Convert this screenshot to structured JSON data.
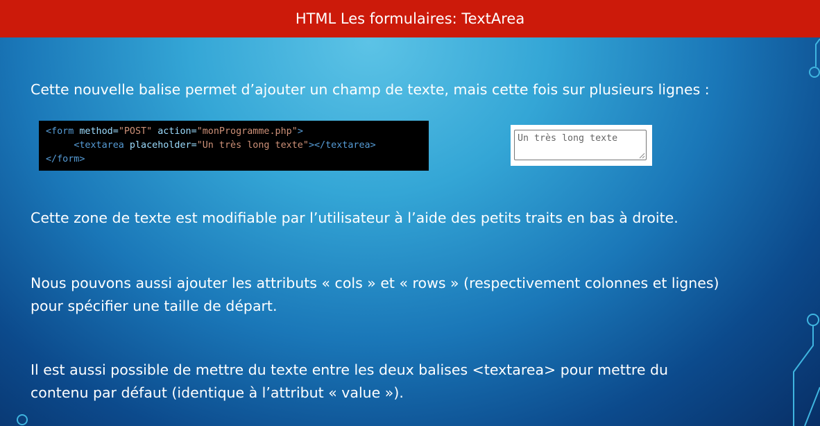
{
  "slide": {
    "title": "HTML Les formulaires: TextArea"
  },
  "paragraphs": {
    "intro": "Cette nouvelle balise permet d’ajouter un champ de texte, mais cette fois sur plusieurs lignes :",
    "resize": "Cette zone de texte est modifiable par l’utilisateur à l’aide des petits traits en bas à droite.",
    "cols_rows_line1": "Nous pouvons aussi ajouter les attributs « cols » et « rows » (respectivement colonnes et lignes)",
    "cols_rows_line2": "pour spécifier une taille de départ.",
    "default_line1": "Il est aussi possible de mettre du texte entre les deux balises <textarea> pour mettre du",
    "default_line2": "contenu par défaut (identique à l’attribut « value »)."
  },
  "code": {
    "line1": {
      "open": "<form",
      "attr1": " method=",
      "val1": "\"POST\"",
      "attr2": " action=",
      "val2": "\"monProgramme.php\"",
      "close": ">"
    },
    "line2": {
      "indent": "     ",
      "open": "<textarea",
      "attr1": " placeholder=",
      "val1": "\"Un très long texte\"",
      "close": "></textarea>"
    },
    "line3": {
      "tag": "</form>"
    }
  },
  "demo_textarea": {
    "placeholder": "Un très long texte"
  },
  "colors": {
    "title_bar": "#cc1a0a",
    "text": "#ffffff",
    "code_bg": "#000000",
    "code_tag": "#569cd6",
    "code_attr": "#9cdcfe",
    "code_value": "#ce9178",
    "decoration": "#3fb5e0"
  }
}
